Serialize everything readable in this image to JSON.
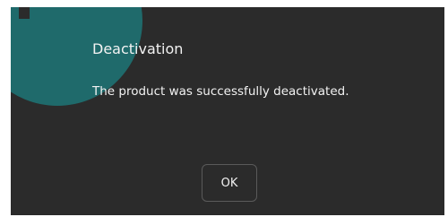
{
  "dialog": {
    "icon": "info-icon",
    "title": "Deactivation",
    "message": "The product was successfully deactivated.",
    "ok_label": "OK"
  },
  "colors": {
    "dialog_background": "#2b2b2b",
    "icon_accent": "#1f6a6b",
    "text": "#f2f2f2",
    "button_border": "#5a5a5a"
  }
}
